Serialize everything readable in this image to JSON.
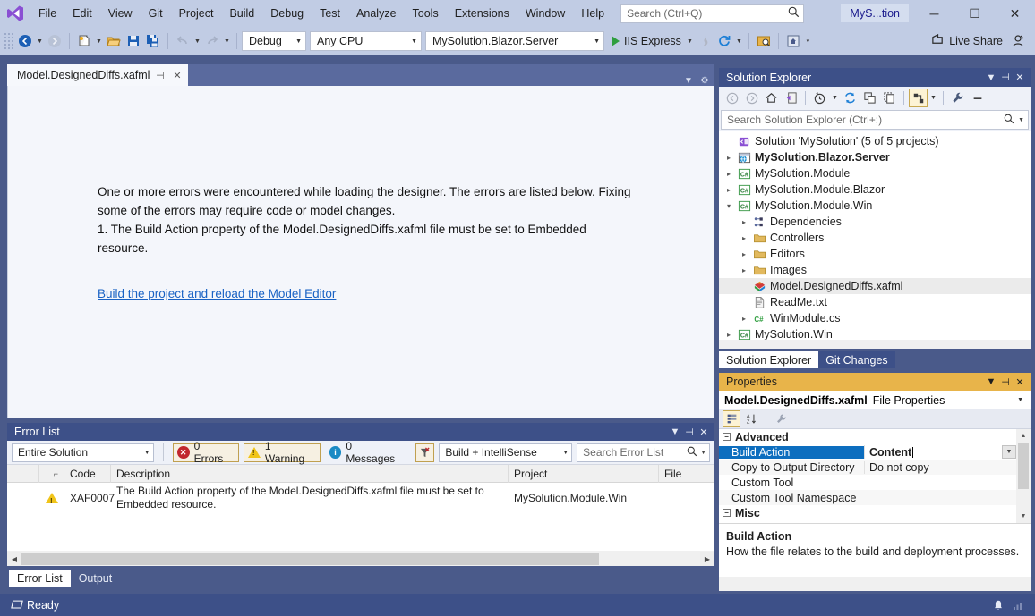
{
  "titlebar": {
    "logo_icon": "visual-studio-logo",
    "menus": [
      "File",
      "Edit",
      "View",
      "Git",
      "Project",
      "Build",
      "Debug",
      "Test",
      "Analyze",
      "Tools",
      "Extensions",
      "Window",
      "Help"
    ],
    "search_placeholder": "Search (Ctrl+Q)",
    "search_icon": "search-icon",
    "solution_name": "MyS...tion",
    "minimize": "─",
    "maximize": "☐",
    "close": "✕"
  },
  "toolbar": {
    "back_icon": "navigate-back-icon",
    "forward_icon": "navigate-forward-icon",
    "new_item_icon": "new-item-icon",
    "open_icon": "open-file-icon",
    "save_icon": "save-icon",
    "save_all_icon": "save-all-icon",
    "undo_icon": "undo-icon",
    "redo_icon": "redo-icon",
    "configuration": "Debug",
    "platform": "Any CPU",
    "startup_project": "MySolution.Blazor.Server",
    "run_label": "IIS Express",
    "hot_reload_icon": "hot-reload-icon",
    "restart_icon": "restart-icon",
    "preview_icon": "preview-icon",
    "live_share_label": "Live Share",
    "live_share_icon": "live-share-icon",
    "feedback_icon": "feedback-icon"
  },
  "document": {
    "tab_label": "Model.DesignedDiffs.xafml",
    "pin_icon": "pin-icon",
    "close_icon": "close-icon",
    "error_text": "One or more errors were encountered while loading the designer. The errors are listed below. Fixing some of the errors may require code or model changes.\n1. The Build Action property of the Model.DesignedDiffs.xafml file must be set to Embedded resource.",
    "link_label": "Build the project and reload the Model Editor"
  },
  "error_list": {
    "title": "Error List",
    "scope": "Entire Solution",
    "errors_label": "0 Errors",
    "warnings_label": "1 Warning",
    "messages_label": "0 Messages",
    "filter_icon": "clear-filter-icon",
    "source": "Build + IntelliSense",
    "search_placeholder": "Search Error List",
    "columns": [
      "",
      "",
      "Code",
      "Description",
      "Project",
      "File"
    ],
    "rows": [
      {
        "severity_icon": "warning-icon",
        "code": "XAF0007",
        "description": "The Build Action property of the Model.DesignedDiffs.xafml file must be set to Embedded resource.",
        "project": "MySolution.Module.Win",
        "file": ""
      }
    ],
    "tabs": [
      {
        "label": "Error List",
        "active": true
      },
      {
        "label": "Output",
        "active": false
      }
    ]
  },
  "solution_explorer": {
    "title": "Solution Explorer",
    "toolbar_icons": [
      "back-icon",
      "forward-icon",
      "home-icon",
      "pending-changes-icon",
      "view-history-icon",
      "refresh-icon",
      "collapse-all-icon",
      "show-all-files-icon",
      "properties-icon",
      "wrench-icon",
      "minus-icon"
    ],
    "search_placeholder": "Search Solution Explorer (Ctrl+;)",
    "tree": [
      {
        "depth": 0,
        "expander": "",
        "icon": "solution-icon",
        "label": "Solution 'MySolution' (5 of 5 projects)",
        "bold": false,
        "selected": false
      },
      {
        "depth": 0,
        "expander": "▸",
        "icon": "web-project-icon",
        "label": "MySolution.Blazor.Server",
        "bold": true,
        "selected": false
      },
      {
        "depth": 0,
        "expander": "▸",
        "icon": "csharp-project-icon",
        "label": "MySolution.Module",
        "bold": false,
        "selected": false
      },
      {
        "depth": 0,
        "expander": "▸",
        "icon": "csharp-project-icon",
        "label": "MySolution.Module.Blazor",
        "bold": false,
        "selected": false
      },
      {
        "depth": 0,
        "expander": "▾",
        "icon": "csharp-project-icon",
        "label": "MySolution.Module.Win",
        "bold": false,
        "selected": false
      },
      {
        "depth": 1,
        "expander": "▸",
        "icon": "dependencies-icon",
        "label": "Dependencies",
        "bold": false,
        "selected": false
      },
      {
        "depth": 1,
        "expander": "▸",
        "icon": "folder-icon",
        "label": "Controllers",
        "bold": false,
        "selected": false
      },
      {
        "depth": 1,
        "expander": "▸",
        "icon": "folder-icon",
        "label": "Editors",
        "bold": false,
        "selected": false
      },
      {
        "depth": 1,
        "expander": "▸",
        "icon": "folder-icon",
        "label": "Images",
        "bold": false,
        "selected": false
      },
      {
        "depth": 1,
        "expander": "",
        "icon": "xafml-icon",
        "label": "Model.DesignedDiffs.xafml",
        "bold": false,
        "selected": true
      },
      {
        "depth": 1,
        "expander": "",
        "icon": "text-file-icon",
        "label": "ReadMe.txt",
        "bold": false,
        "selected": false
      },
      {
        "depth": 1,
        "expander": "▸",
        "icon": "csharp-file-icon",
        "label": "WinModule.cs",
        "bold": false,
        "selected": false
      },
      {
        "depth": 0,
        "expander": "▸",
        "icon": "csharp-project-icon",
        "label": "MySolution.Win",
        "bold": false,
        "selected": false
      }
    ],
    "tabs": [
      {
        "label": "Solution Explorer",
        "active": true
      },
      {
        "label": "Git Changes",
        "active": false
      }
    ]
  },
  "properties": {
    "title": "Properties",
    "object_name": "Model.DesignedDiffs.xafml",
    "object_type": "File Properties",
    "toolbar_icons": [
      "categorized-icon",
      "alphabetical-icon",
      "property-pages-icon"
    ],
    "categories": [
      {
        "name": "Advanced",
        "expanded": true,
        "rows": [
          {
            "name": "Build Action",
            "value": "Content",
            "selected": true,
            "editing": true,
            "has_dropdown": true
          },
          {
            "name": "Copy to Output Directory",
            "value": "Do not copy",
            "selected": false,
            "editing": false,
            "has_dropdown": false
          },
          {
            "name": "Custom Tool",
            "value": "",
            "selected": false,
            "editing": false,
            "has_dropdown": false
          },
          {
            "name": "Custom Tool Namespace",
            "value": "",
            "selected": false,
            "editing": false,
            "has_dropdown": false
          }
        ]
      },
      {
        "name": "Misc",
        "expanded": true,
        "rows": []
      }
    ],
    "description_title": "Build Action",
    "description_body": "How the file relates to the build and deployment processes."
  },
  "statusbar": {
    "status_icon": "ready-icon",
    "status_text": "Ready",
    "notification_icon": "bell-icon",
    "feedback_icon": "signal-icon"
  },
  "colors": {
    "titlebar_bg": "#c1cce4",
    "chrome_bg": "#4a5a8a",
    "panel_header_bg": "#3d5088",
    "properties_header_bg": "#e8b44a",
    "accent_blue": "#0d6ebf",
    "link": "#1962c4",
    "error_red": "#c1272d",
    "warning_yellow": "#f0c419",
    "info_blue": "#1a8ac4",
    "run_green": "#2e9e3e"
  }
}
